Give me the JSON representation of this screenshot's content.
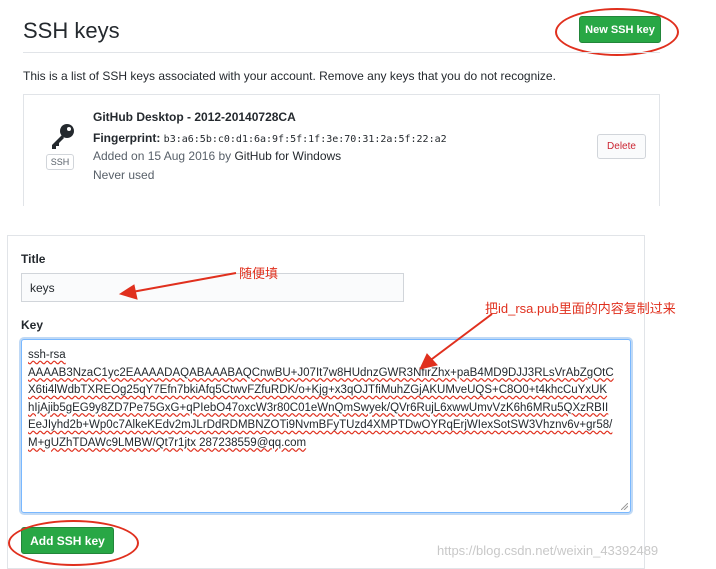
{
  "header": {
    "title": "SSH keys",
    "new_key_button": "New SSH key"
  },
  "intro_text": "This is a list of SSH keys associated with your account. Remove any keys that you do not recognize.",
  "keys": [
    {
      "title": "GitHub Desktop - 2012-20140728CA",
      "fingerprint_label": "Fingerprint:",
      "fingerprint": "b3:a6:5b:c0:d1:6a:9f:5f:1f:3e:70:31:2a:5f:22:a2",
      "added_prefix": "Added on 15 Aug 2016 by",
      "added_by": "GitHub for Windows",
      "usage": "Never used",
      "badge": "SSH",
      "delete_label": "Delete",
      "icon": "key-icon"
    }
  ],
  "form": {
    "title_label": "Title",
    "title_value": "keys",
    "key_label": "Key",
    "key_value_lines": [
      "ssh-rsa",
      "AAAAB3NzaC1yc2EAAAADAQABAAABAQCnwBU+J07It7w8HUdnzGWR3NfirZhx+paB4MD9DJJ3RLsVrAbZgOtC",
      "X6ti4lWdbTXREOg25qY7Efn7bkiAfq5CtwvFZfuRDK/o+Kjg+x3qOJTfiMuhZGjAKUMveUQS+C8O0+t4khcCuYxUK",
      "hIjAjib5gEG9y8ZD7Pe75GxG+qPIebO47oxcW3r80C01eWnQmSwyek/QVr6RujL6xwwUmvVzK6h6MRu5QXzRBII",
      "EeJIyhd2b+Wp0c7AlkeKEdv2mJLrDdRDMBNZOTi9NvmBFyTUzd4XMPTDwOYRqErjWIexSotSW3Vhznv6v+gr58/",
      "M+gUZhTDAWc9LMBW/Qt7r1jtx 287238559@qq.com"
    ],
    "add_button": "Add SSH key"
  },
  "annotations": {
    "title_note": "随便填",
    "key_note": "把id_rsa.pub里面的内容复制过来"
  },
  "watermark": "https://blog.csdn.net/weixin_43392489",
  "colors": {
    "primary_green": "#28a745",
    "annotation_red": "#e0301e",
    "delete_red": "#cb2431",
    "focus_blue": "#79b8ff"
  }
}
